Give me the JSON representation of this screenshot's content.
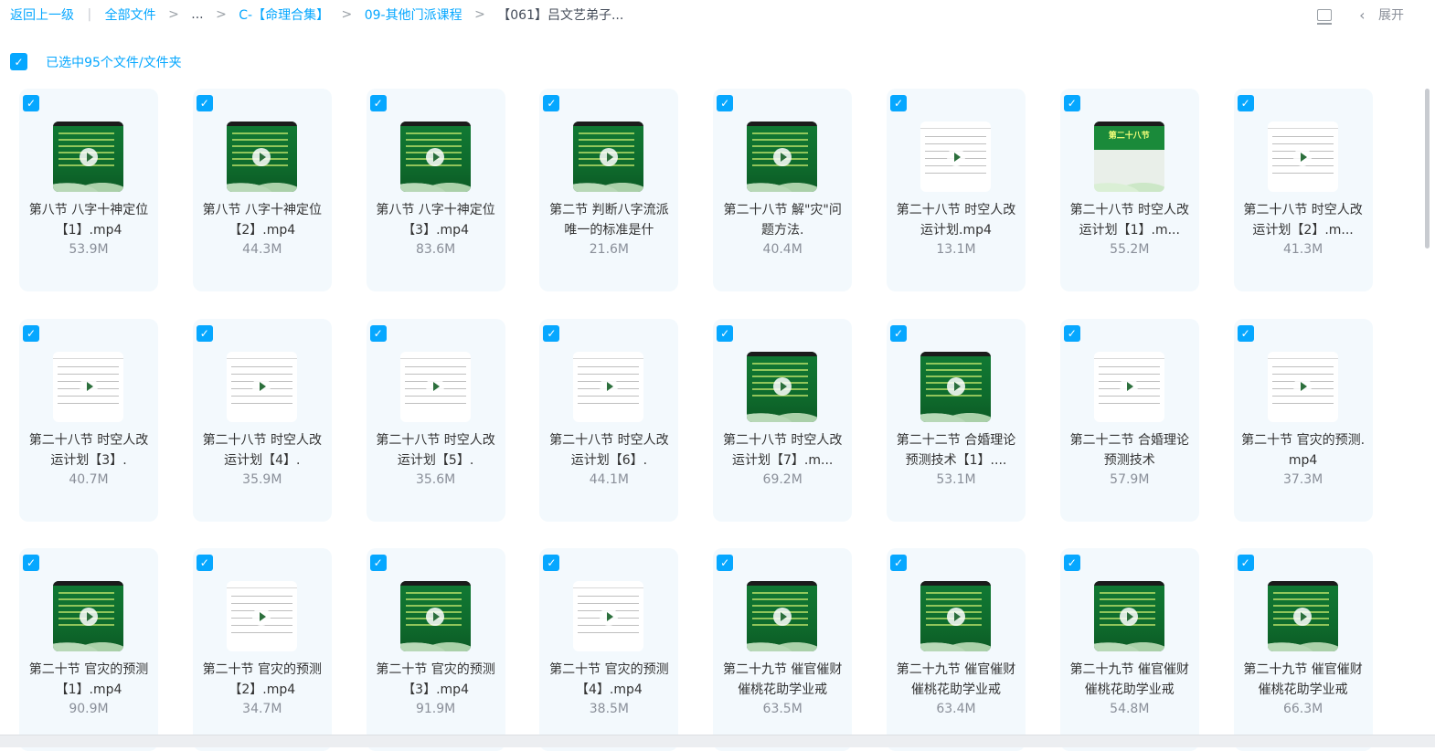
{
  "breadcrumb": {
    "back": "返回上一级",
    "all_files": "全部文件",
    "ellipsis": "...",
    "level1": "C-【命理合集】",
    "level2": "09-其他门派课程",
    "current": "【061】吕文艺弟子..."
  },
  "toolbar": {
    "expand_label": "展开"
  },
  "selection": {
    "label": "已选中95个文件/文件夹"
  },
  "files": [
    {
      "name": "第八节 八字十神定位【1】.mp4",
      "size": "53.9M",
      "thumb": "green"
    },
    {
      "name": "第八节 八字十神定位【2】.mp4",
      "size": "44.3M",
      "thumb": "green"
    },
    {
      "name": "第八节 八字十神定位【3】.mp4",
      "size": "83.6M",
      "thumb": "green"
    },
    {
      "name": "第二节 判断八字流派唯一的标准是什",
      "size": "21.6M",
      "thumb": "green"
    },
    {
      "name": "第二十八节 解\"灾\"问题方法.",
      "size": "40.4M",
      "thumb": "green"
    },
    {
      "name": "第二十八节 时空人改运计划.mp4",
      "size": "13.1M",
      "thumb": "white"
    },
    {
      "name": "第二十八节 时空人改运计划【1】.m...",
      "size": "55.2M",
      "thumb": "title"
    },
    {
      "name": "第二十八节 时空人改运计划【2】.m...",
      "size": "41.3M",
      "thumb": "white"
    },
    {
      "name": "第二十八节 时空人改运计划【3】.",
      "size": "40.7M",
      "thumb": "white"
    },
    {
      "name": "第二十八节 时空人改运计划【4】.",
      "size": "35.9M",
      "thumb": "white"
    },
    {
      "name": "第二十八节 时空人改运计划【5】.",
      "size": "35.6M",
      "thumb": "white"
    },
    {
      "name": "第二十八节 时空人改运计划【6】.",
      "size": "44.1M",
      "thumb": "white"
    },
    {
      "name": "第二十八节 时空人改运计划【7】.m...",
      "size": "69.2M",
      "thumb": "green"
    },
    {
      "name": "第二十二节 合婚理论预测技术【1】....",
      "size": "53.1M",
      "thumb": "green"
    },
    {
      "name": "第二十二节 合婚理论预测技术",
      "size": "57.9M",
      "thumb": "white"
    },
    {
      "name": "第二十节 官灾的预测.mp4",
      "size": "37.3M",
      "thumb": "white"
    },
    {
      "name": "第二十节 官灾的预测【1】.mp4",
      "size": "90.9M",
      "thumb": "green"
    },
    {
      "name": "第二十节 官灾的预测【2】.mp4",
      "size": "34.7M",
      "thumb": "white"
    },
    {
      "name": "第二十节 官灾的预测【3】.mp4",
      "size": "91.9M",
      "thumb": "green"
    },
    {
      "name": "第二十节 官灾的预测【4】.mp4",
      "size": "38.5M",
      "thumb": "white"
    },
    {
      "name": "第二十九节 催官催财催桃花助学业戒",
      "size": "63.5M",
      "thumb": "green"
    },
    {
      "name": "第二十九节 催官催财催桃花助学业戒",
      "size": "63.4M",
      "thumb": "green"
    },
    {
      "name": "第二十九节 催官催财催桃花助学业戒",
      "size": "54.8M",
      "thumb": "green"
    },
    {
      "name": "第二十九节 催官催财催桃花助学业戒",
      "size": "66.3M",
      "thumb": "green"
    }
  ],
  "thumb_title_text": "第二十八节",
  "colors": {
    "accent": "#06a7ff",
    "card_bg": "#f3f9fd",
    "muted": "#8a8f99"
  }
}
